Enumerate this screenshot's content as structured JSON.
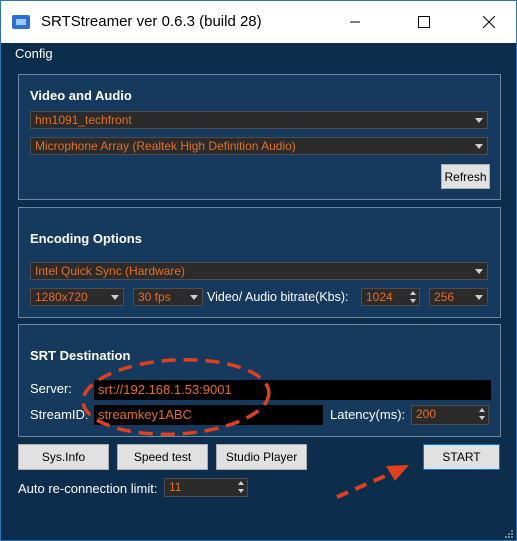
{
  "window": {
    "title": "SRTStreamer ver 0.6.3 (build 28)",
    "controls": [
      "minimize",
      "maximize",
      "close"
    ]
  },
  "menu": {
    "config_label": "Config"
  },
  "video_audio": {
    "title": "Video and Audio",
    "video_source": "hm1091_techfront",
    "audio_source": "Microphone Array (Realtek High Definition Audio)",
    "refresh_label": "Refresh"
  },
  "encoding": {
    "title": "Encoding Options",
    "encoder": "Intel Quick Sync (Hardware)",
    "resolution": "1280x720",
    "fps": "30 fps",
    "bitrate_label": "Video/ Audio bitrate(Kbs):",
    "video_bitrate": "1024",
    "audio_bitrate": "256"
  },
  "srt": {
    "title": "SRT Destination",
    "server_label": "Server:",
    "server_value": "srt://192.168.1.53:9001",
    "streamid_label": "StreamID:",
    "streamid_value": "streamkey1ABC",
    "latency_label": "Latency(ms):",
    "latency_value": "200"
  },
  "buttons": {
    "sysinfo": "Sys.Info",
    "speedtest": "Speed test",
    "studioplayer": "Studio Player",
    "start": "START"
  },
  "reconnect": {
    "label": "Auto re-connection limit:",
    "value": "11"
  },
  "annotation_color": "#e0401c",
  "accent_text_color": "#e66f1f"
}
